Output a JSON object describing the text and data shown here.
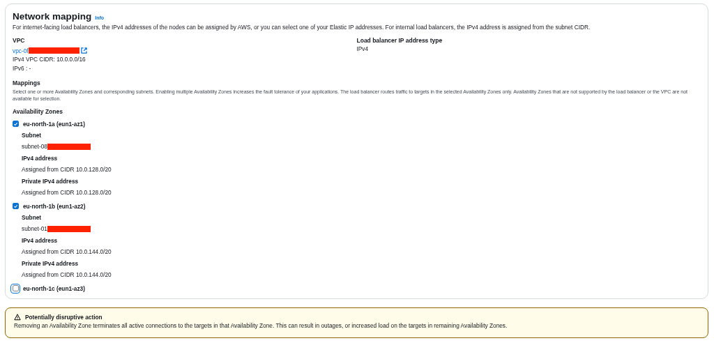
{
  "section": {
    "title": "Network mapping",
    "info_link": "Info",
    "description": "For internet-facing load balancers, the IPv4 addresses of the nodes can be assigned by AWS, or you can select one of your Elastic IP addresses. For internal load balancers, the IPv4 address is assigned from the subnet CIDR."
  },
  "vpc": {
    "label": "VPC",
    "link": "vpc-0f",
    "redacted": true,
    "cidr": "IPv4 VPC CIDR: 10.0.0.0/16",
    "ipv6": "IPv6 : -"
  },
  "ip_type": {
    "label": "Load balancer IP address type",
    "value": "IPv4"
  },
  "mappings": {
    "label": "Mappings",
    "description": "Select one or more Availability Zones and corresponding subnets. Enabling multiple Availability Zones increases the fault tolerance of your applications. The load balancer routes traffic to targets in the selected Availability Zones only. Availability Zones that are not supported by the load balancer or the VPC are not available for selection.",
    "zones_label": "Availability Zones"
  },
  "zones": [
    {
      "name": "eu-north-1a (eun1-az1)",
      "checked": true,
      "focused": false,
      "fields": [
        {
          "label": "Subnet",
          "value": "subnet-08",
          "redacted": true
        },
        {
          "label": "IPv4 address",
          "value": "Assigned from CIDR 10.0.128.0/20"
        },
        {
          "label": "Private IPv4 address",
          "value": "Assigned from CIDR 10.0.128.0/20"
        }
      ]
    },
    {
      "name": "eu-north-1b (eun1-az2)",
      "checked": true,
      "focused": false,
      "fields": [
        {
          "label": "Subnet",
          "value": "subnet-01",
          "redacted": true
        },
        {
          "label": "IPv4 address",
          "value": "Assigned from CIDR 10.0.144.0/20"
        },
        {
          "label": "Private IPv4 address",
          "value": "Assigned from CIDR 10.0.144.0/20"
        }
      ]
    },
    {
      "name": "eu-north-1c (eun1-az3)",
      "checked": false,
      "focused": true
    }
  ],
  "warning": {
    "title": "Potentially disruptive action",
    "text": "Removing an Availability Zone terminates all active connections to the targets in that Availability Zone. This can result in outages, or increased load on the targets in remaining Availability Zones."
  }
}
